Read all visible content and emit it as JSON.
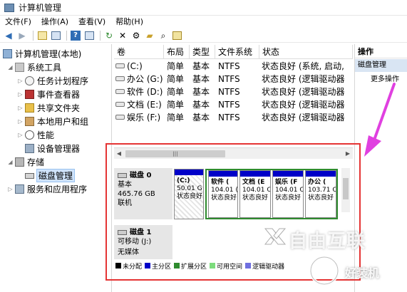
{
  "window": {
    "title": "计算机管理"
  },
  "menu": [
    "文件(F)",
    "操作(A)",
    "查看(V)",
    "帮助(H)"
  ],
  "toolbar": [
    "back-icon",
    "forward-icon",
    "up-icon",
    "show-hide-tree-icon",
    "help-icon",
    "properties-icon",
    "refresh-icon",
    "delete-icon",
    "settings-icon",
    "open-folder-icon",
    "search-icon",
    "export-icon"
  ],
  "tree": {
    "root": "计算机管理(本地)",
    "system_tools": "系统工具",
    "task_scheduler": "任务计划程序",
    "event_viewer": "事件查看器",
    "shared_folders": "共享文件夹",
    "local_users": "本地用户和组",
    "performance": "性能",
    "device_manager": "设备管理器",
    "storage": "存储",
    "disk_management": "磁盘管理",
    "services_apps": "服务和应用程序"
  },
  "columns": {
    "volume": "卷",
    "layout": "布局",
    "type": "类型",
    "fs": "文件系统",
    "status": "状态"
  },
  "volumes": [
    {
      "name": "(C:)",
      "layout": "简单",
      "type": "基本",
      "fs": "NTFS",
      "status": "状态良好 (系统, 启动,"
    },
    {
      "name": "办公 (G:)",
      "layout": "简单",
      "type": "基本",
      "fs": "NTFS",
      "status": "状态良好 (逻辑驱动器"
    },
    {
      "name": "软件 (D:)",
      "layout": "简单",
      "type": "基本",
      "fs": "NTFS",
      "status": "状态良好 (逻辑驱动器"
    },
    {
      "name": "文档 (E:)",
      "layout": "简单",
      "type": "基本",
      "fs": "NTFS",
      "status": "状态良好 (逻辑驱动器"
    },
    {
      "name": "娱乐 (F:)",
      "layout": "简单",
      "type": "基本",
      "fs": "NTFS",
      "status": "状态良好 (逻辑驱动器"
    }
  ],
  "actions": {
    "header": "操作",
    "current": "磁盘管理",
    "more": "更多操作"
  },
  "disks": [
    {
      "name": "磁盘 0",
      "type": "基本",
      "size": "465.76 GB",
      "state": "联机",
      "partitions": [
        {
          "label": "(C:)",
          "size": "50.01 G",
          "status": "状态良好"
        },
        {
          "label": "软件 (",
          "size": "104.01 (",
          "status": "状态良好"
        },
        {
          "label": "文档 (E",
          "size": "104.01 C",
          "status": "状态良好"
        },
        {
          "label": "娱乐 (F",
          "size": "104.01 C",
          "status": "状态良好"
        },
        {
          "label": "办公 (",
          "size": "103.71 C",
          "status": "状态良好"
        }
      ]
    },
    {
      "name": "磁盘 1",
      "type": "可移动 (J:)",
      "size": "",
      "state": "无媒体"
    }
  ],
  "legend": [
    {
      "label": "未分配",
      "color": "#000000"
    },
    {
      "label": "主分区",
      "color": "#0000c8"
    },
    {
      "label": "扩展分区",
      "color": "#2e8b2e"
    },
    {
      "label": "可用空间",
      "color": "#7ddc7d"
    },
    {
      "label": "逻辑驱动器",
      "color": "#6f6fe0"
    }
  ],
  "watermark": {
    "brand": "自由互联",
    "site": "好装机"
  },
  "colors": {
    "primary": "#0000c8",
    "extended": "#2e8b2e",
    "highlight": "#e53434",
    "arrow": "#e040e0"
  }
}
